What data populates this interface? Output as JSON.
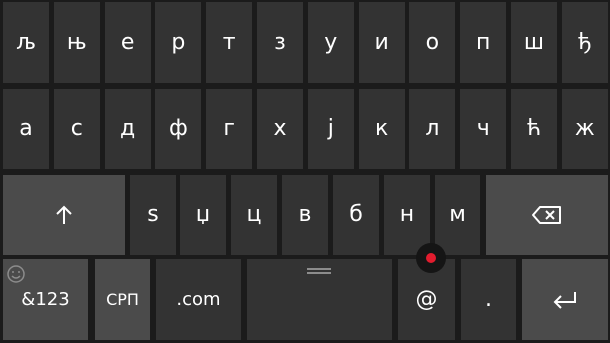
{
  "keyboard": {
    "row1": [
      "љ",
      "њ",
      "е",
      "р",
      "т",
      "з",
      "у",
      "и",
      "о",
      "п",
      "ш",
      "ђ"
    ],
    "row2": [
      "а",
      "с",
      "д",
      "ф",
      "г",
      "х",
      "ј",
      "к",
      "л",
      "ч",
      "ћ",
      "ж"
    ],
    "row3": [
      "s",
      "џ",
      "ц",
      "в",
      "б",
      "н",
      "м"
    ],
    "bottom": {
      "numbers_label": "&123",
      "language_label": "СРП",
      "dotcom_label": ".com",
      "at_label": "@",
      "period_label": "."
    },
    "icons": {
      "shift": "shift-arrow-up-icon",
      "backspace": "backspace-icon",
      "enter": "enter-icon",
      "emoji": "emoji-smiley-icon",
      "spacebar_handle": "spacebar-grip-icon",
      "cursor": "cursor-control-icon"
    },
    "colors": {
      "background": "#1b1b1b",
      "key": "#333333",
      "function_key": "#4b4b4b",
      "text": "#ffffff",
      "cursor_accent": "#e21c2e"
    }
  }
}
